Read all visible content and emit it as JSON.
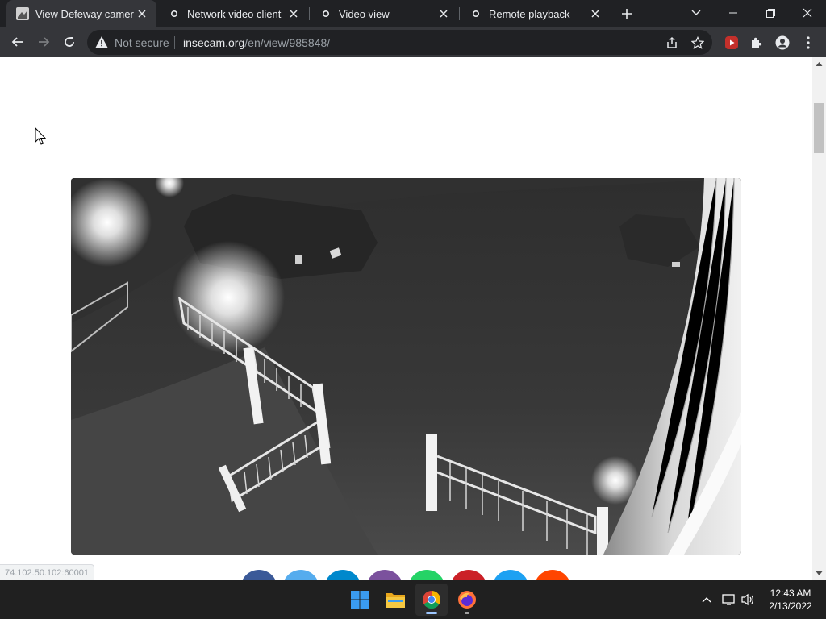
{
  "tabs": [
    {
      "title": "View Defeway camera",
      "active": true
    },
    {
      "title": "Network video client",
      "active": false
    },
    {
      "title": "Video view",
      "active": false
    },
    {
      "title": "Remote playback",
      "active": false
    }
  ],
  "toolbar": {
    "security_label": "Not secure",
    "url_host": "insecam.org",
    "url_path": "/en/view/985848/"
  },
  "page": {
    "status_url": "74.102.50.102:60001",
    "share_buttons": [
      {
        "icon": "facebook-icon",
        "color": "#3b5998"
      },
      {
        "icon": "twitter-icon",
        "color": "#55acee"
      },
      {
        "icon": "telegram-icon",
        "color": "#0088cc"
      },
      {
        "icon": "viber-icon",
        "color": "#7b519d"
      },
      {
        "icon": "whatsapp-icon",
        "color": "#25d366"
      },
      {
        "icon": "pinterest-icon",
        "color": "#cb2027"
      },
      {
        "icon": "share-icon",
        "color": "#1da1f2"
      },
      {
        "icon": "reddit-icon",
        "color": "#ff4500"
      }
    ]
  },
  "taskbar": {
    "time": "12:43 AM",
    "date": "2/13/2022"
  },
  "colors": {
    "tabstrip_bg": "#202124",
    "toolbar_bg": "#35363a",
    "taskbar_bg": "#202020"
  }
}
